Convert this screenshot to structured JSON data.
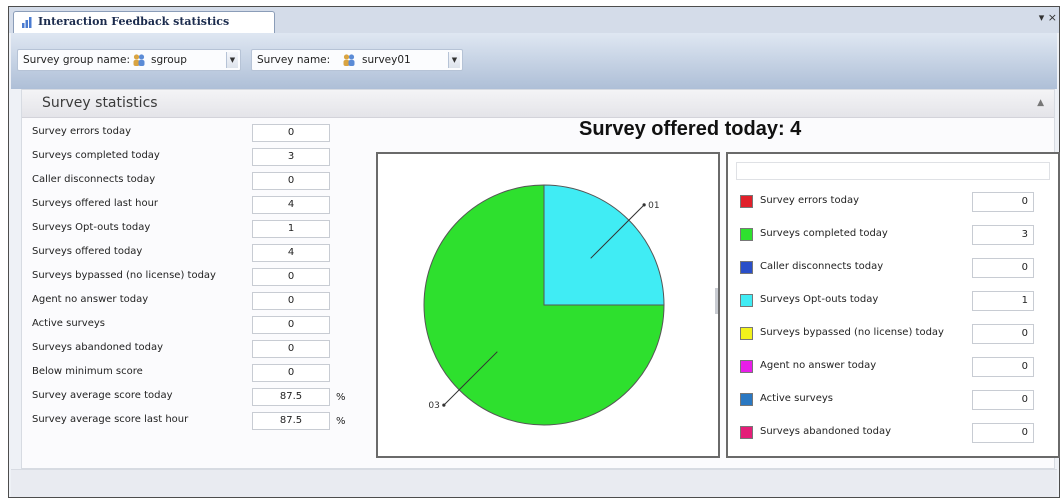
{
  "window": {
    "title": "Interaction Feedback statistics",
    "controls": "▾ ×"
  },
  "toolbar": {
    "survey_group_label": "Survey group name:",
    "survey_group_value": "sgroup",
    "survey_name_label": "Survey name:",
    "survey_name_value": "survey01"
  },
  "section": {
    "title": "Survey statistics"
  },
  "stats": [
    {
      "label": "Survey errors today",
      "value": "0",
      "unit": ""
    },
    {
      "label": "Surveys completed today",
      "value": "3",
      "unit": ""
    },
    {
      "label": "Caller disconnects today",
      "value": "0",
      "unit": ""
    },
    {
      "label": "Surveys offered last hour",
      "value": "4",
      "unit": ""
    },
    {
      "label": "Surveys Opt-outs today",
      "value": "1",
      "unit": ""
    },
    {
      "label": "Surveys offered today",
      "value": "4",
      "unit": ""
    },
    {
      "label": "Surveys bypassed (no license) today",
      "value": "0",
      "unit": ""
    },
    {
      "label": "Agent no answer today",
      "value": "0",
      "unit": ""
    },
    {
      "label": "Active surveys",
      "value": "0",
      "unit": ""
    },
    {
      "label": "Surveys abandoned today",
      "value": "0",
      "unit": ""
    },
    {
      "label": "Below minimum score",
      "value": "0",
      "unit": ""
    },
    {
      "label": "Survey average score today",
      "value": "87.5",
      "unit": "%"
    },
    {
      "label": "Survey average score last hour",
      "value": "87.5",
      "unit": "%"
    }
  ],
  "legend": [
    {
      "label": "Survey errors today",
      "value": "0",
      "color": "#e0202a"
    },
    {
      "label": "Surveys completed today",
      "value": "3",
      "color": "#2ee02e"
    },
    {
      "label": "Caller disconnects today",
      "value": "0",
      "color": "#2a4fc8"
    },
    {
      "label": "Surveys Opt-outs today",
      "value": "1",
      "color": "#40ecf4"
    },
    {
      "label": "Surveys bypassed (no license) today",
      "value": "0",
      "color": "#f2f21c"
    },
    {
      "label": "Agent no answer today",
      "value": "0",
      "color": "#e81ee8"
    },
    {
      "label": "Active surveys",
      "value": "0",
      "color": "#2a78c2"
    },
    {
      "label": "Surveys abandoned today",
      "value": "0",
      "color": "#e41e78"
    }
  ],
  "chart_data": {
    "type": "pie",
    "title": "Survey offered today: 4",
    "slices": [
      {
        "label": "01",
        "value": 1,
        "color": "#40ecf4"
      },
      {
        "label": "03",
        "value": 3,
        "color": "#2ee02e"
      }
    ]
  }
}
